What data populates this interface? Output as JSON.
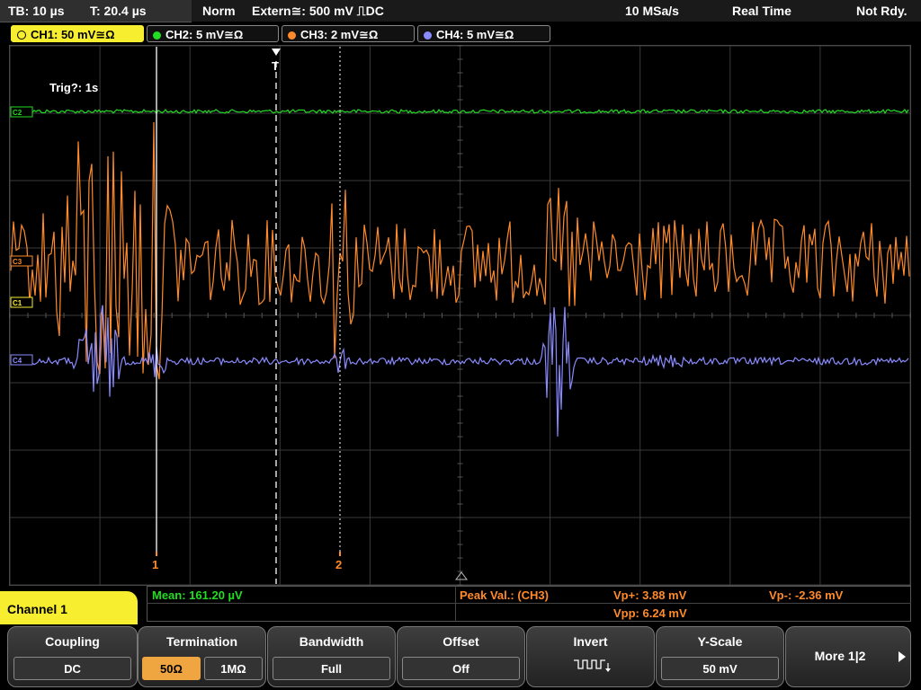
{
  "status": {
    "timebase": "TB: 10 µs",
    "trigger_time": "T: 20.4 µs",
    "mode": "Norm",
    "trigger_source": "Extern≅: 500 mV ⎍DC",
    "sample_rate": "10 MSa/s",
    "acq_mode": "Real Time",
    "state": "Not Rdy."
  },
  "channels": [
    {
      "label": "CH1: 50 mV≅Ω",
      "color": "#f7ee2f"
    },
    {
      "label": "CH2: 5 mV≅Ω",
      "color": "#22dd22"
    },
    {
      "label": "CH3: 2 mV≅Ω",
      "color": "#ff8a2a"
    },
    {
      "label": "CH4: 5 mV≅Ω",
      "color": "#8a8aff"
    }
  ],
  "screen": {
    "trigger_label": "Trig?: 1s",
    "trigger_marker": "T",
    "cursor1": "1",
    "cursor2": "2",
    "ch_markers": [
      "C2",
      "C3",
      "C1",
      "C4"
    ]
  },
  "measurements": {
    "mean": "Mean: 161.20 µV",
    "peak_title": "Peak Val.:  (CH3)",
    "vp_plus": "Vp+: 3.88 mV",
    "vp_minus": "Vp-: -2.36 mV",
    "vpp": "Vpp: 6.24 mV"
  },
  "menu": {
    "title": "Channel 1",
    "coupling": {
      "title": "Coupling",
      "value": "DC"
    },
    "termination": {
      "title": "Termination",
      "opt1": "50Ω",
      "opt2": "1MΩ"
    },
    "bandwidth": {
      "title": "Bandwidth",
      "value": "Full"
    },
    "offset": {
      "title": "Offset",
      "value": "Off"
    },
    "invert": {
      "title": "Invert"
    },
    "yscale": {
      "title": "Y-Scale",
      "value": "50 mV"
    },
    "more": {
      "label": "More 1|2"
    }
  }
}
